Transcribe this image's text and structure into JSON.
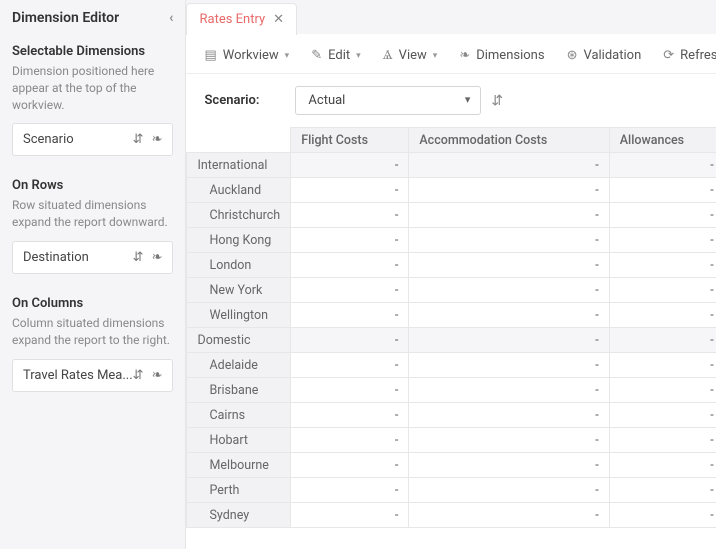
{
  "sidebar": {
    "title": "Dimension Editor",
    "sections": {
      "selectable": {
        "title": "Selectable Dimensions",
        "desc": "Dimension positioned here appear at the top of the workview.",
        "chip": "Scenario"
      },
      "rows": {
        "title": "On Rows",
        "desc": "Row situated dimensions expand the report downward.",
        "chip": "Destination"
      },
      "columns": {
        "title": "On Columns",
        "desc": "Column situated dimensions expand the report to the right.",
        "chip": "Travel Rates Mea..."
      }
    }
  },
  "tab": {
    "label": "Rates Entry"
  },
  "toolbar": {
    "workview": "Workview",
    "edit": "Edit",
    "view": "View",
    "dimensions": "Dimensions",
    "validation": "Validation",
    "refresh": "Refresh"
  },
  "scenario": {
    "label": "Scenario:",
    "value": "Actual"
  },
  "grid": {
    "columns": [
      "Flight Costs",
      "Accommodation Costs",
      "Allowances"
    ],
    "rows": [
      {
        "label": "International",
        "group": true,
        "cells": [
          "-",
          "-",
          "-"
        ]
      },
      {
        "label": "Auckland",
        "group": false,
        "cells": [
          "-",
          "-",
          "-"
        ]
      },
      {
        "label": "Christchurch",
        "group": false,
        "cells": [
          "-",
          "-",
          "-"
        ]
      },
      {
        "label": "Hong Kong",
        "group": false,
        "cells": [
          "-",
          "-",
          "-"
        ]
      },
      {
        "label": "London",
        "group": false,
        "cells": [
          "-",
          "-",
          "-"
        ]
      },
      {
        "label": "New York",
        "group": false,
        "cells": [
          "-",
          "-",
          "-"
        ]
      },
      {
        "label": "Wellington",
        "group": false,
        "cells": [
          "-",
          "-",
          "-"
        ]
      },
      {
        "label": "Domestic",
        "group": true,
        "cells": [
          "-",
          "-",
          "-"
        ]
      },
      {
        "label": "Adelaide",
        "group": false,
        "cells": [
          "-",
          "-",
          "-"
        ]
      },
      {
        "label": "Brisbane",
        "group": false,
        "cells": [
          "-",
          "-",
          "-"
        ]
      },
      {
        "label": "Cairns",
        "group": false,
        "cells": [
          "-",
          "-",
          "-"
        ]
      },
      {
        "label": "Hobart",
        "group": false,
        "cells": [
          "-",
          "-",
          "-"
        ]
      },
      {
        "label": "Melbourne",
        "group": false,
        "cells": [
          "-",
          "-",
          "-"
        ]
      },
      {
        "label": "Perth",
        "group": false,
        "cells": [
          "-",
          "-",
          "-"
        ]
      },
      {
        "label": "Sydney",
        "group": false,
        "cells": [
          "-",
          "-",
          "-"
        ]
      }
    ]
  }
}
